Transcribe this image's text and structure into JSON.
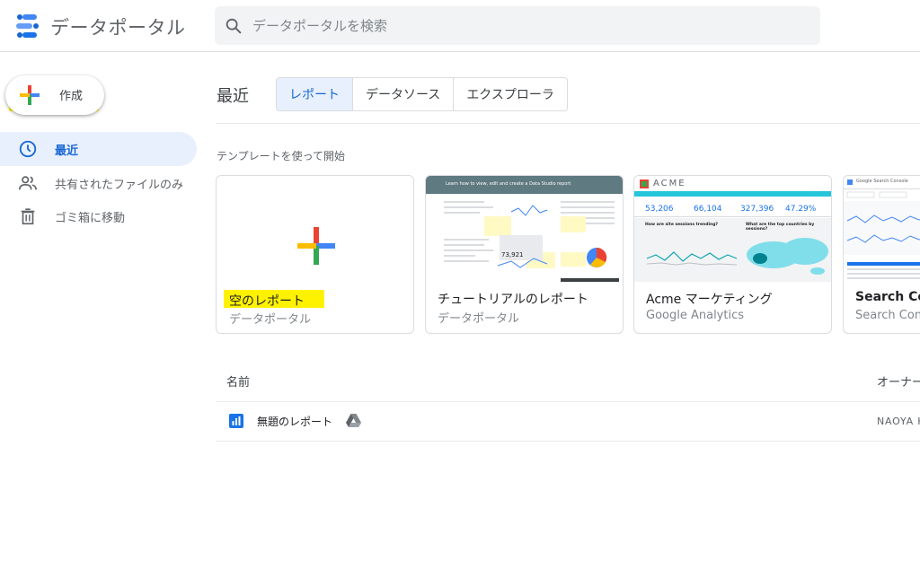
{
  "header": {
    "app_title": "データポータル",
    "search_placeholder": "データポータルを検索"
  },
  "sidebar": {
    "create_label": "作成",
    "items": [
      {
        "label": "最近",
        "icon": "clock-icon",
        "active": true
      },
      {
        "label": "共有されたファイルのみ",
        "icon": "people-icon",
        "active": false
      },
      {
        "label": "ゴミ箱に移動",
        "icon": "trash-icon",
        "active": false
      }
    ]
  },
  "main": {
    "section_title": "最近",
    "tabs": [
      {
        "label": "レポート",
        "active": true
      },
      {
        "label": "データソース",
        "active": false
      },
      {
        "label": "エクスプローラ",
        "active": false
      }
    ],
    "template_heading": "テンプレートを使って開始",
    "templates": [
      {
        "title": "空のレポート",
        "subtitle": "データポータル"
      },
      {
        "title": "チュートリアルのレポート",
        "subtitle": "データポータル",
        "thumb_header": "Learn how to view, edit and create a Data Studio report",
        "thumb_value": "73,921"
      },
      {
        "title": "Acme マーケティング",
        "subtitle": "Google Analytics",
        "thumb_brand": "ACME",
        "thumb_metrics": [
          "53,206",
          "66,104",
          "327,396",
          "47.29%"
        ],
        "thumb_q1": "How are site sessions trending?",
        "thumb_q2": "What are the top countries by sessions?"
      },
      {
        "title": "Search Cons",
        "subtitle": "Search Cons",
        "thumb_header": "Google Search Console"
      }
    ],
    "table": {
      "col_name": "名前",
      "col_owner": "オーナー",
      "rows": [
        {
          "name": "無題のレポート",
          "owner": "NAOYA H"
        }
      ]
    }
  },
  "colors": {
    "accent_blue": "#1967d2",
    "active_bg": "#e8f0fe",
    "highlight_yellow": "#fff200",
    "google_red": "#ea4335",
    "google_yellow": "#fbbc04",
    "google_green": "#34a853",
    "google_blue": "#4285f4"
  }
}
